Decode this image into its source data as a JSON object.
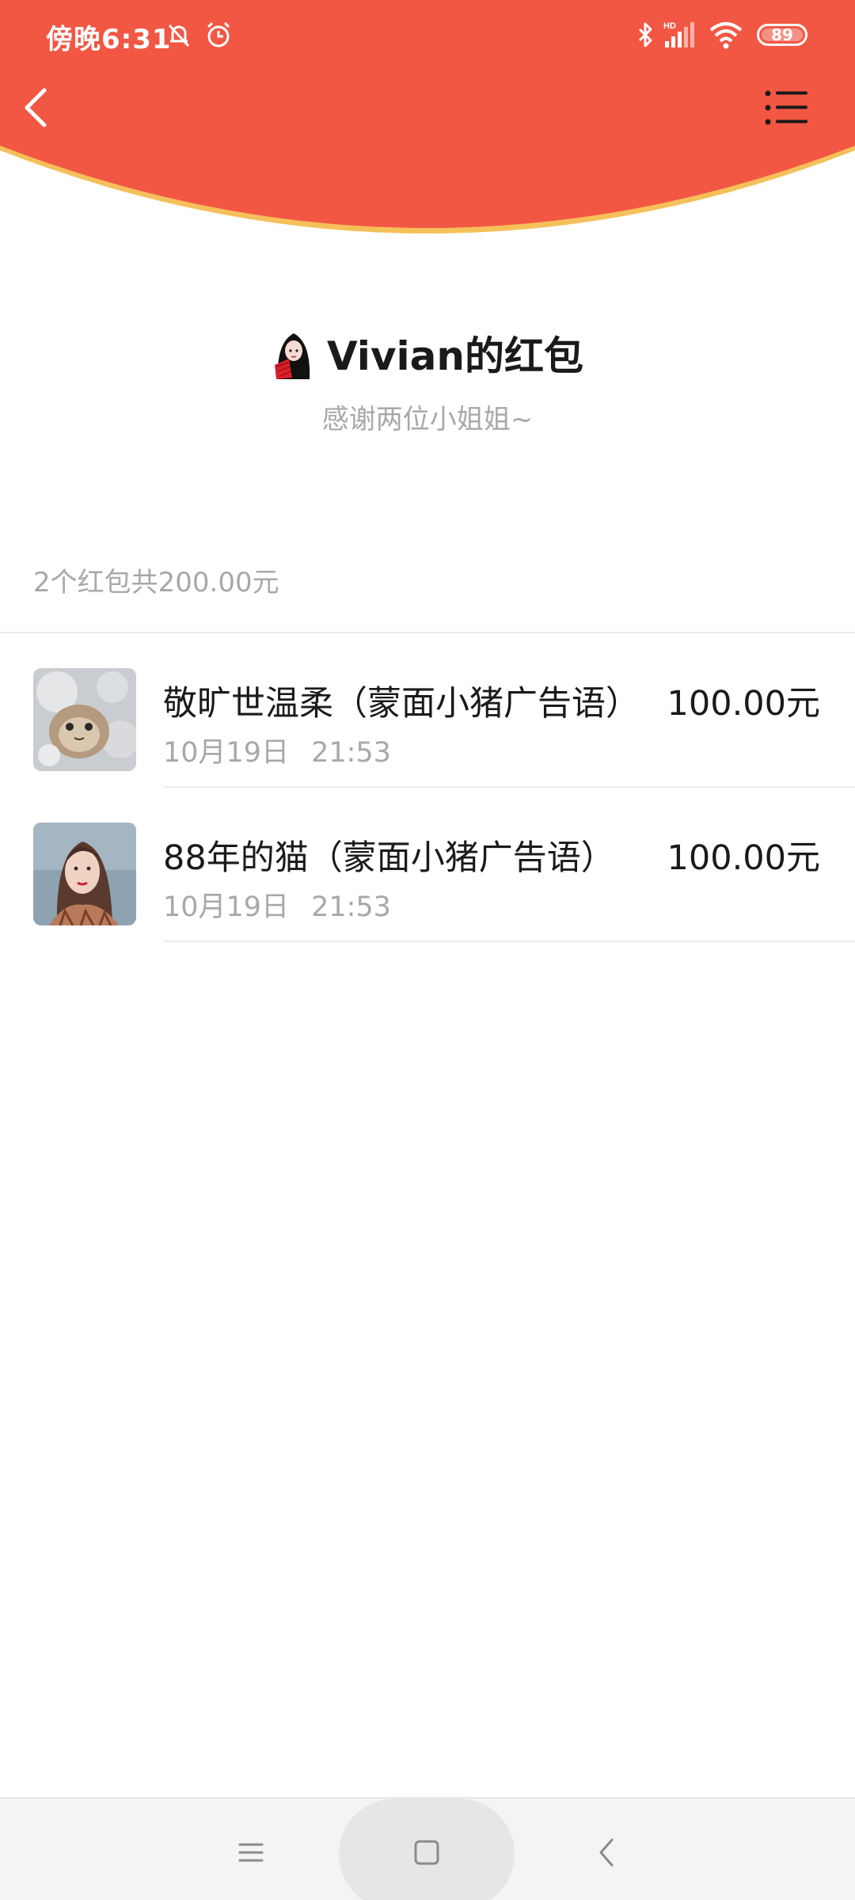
{
  "status_bar": {
    "time": "傍晚6:31",
    "battery": "89",
    "icons": [
      "mute-bell-icon",
      "alarm-icon",
      "bluetooth-icon",
      "hd-signal-icon",
      "wifi-icon",
      "battery-icon"
    ]
  },
  "header": {
    "color": "#f25744",
    "edge_color": "#f5c05a",
    "back_icon": "back-chevron-icon",
    "menu_icon": "list-menu-icon"
  },
  "envelope": {
    "title": "Vivian的红包",
    "message": "感谢两位小姐姐~"
  },
  "summary": {
    "text": "2个红包共200.00元"
  },
  "receivers": [
    {
      "name": "敬旷世温柔（蒙面小猪广告语）",
      "date": "10月19日",
      "time": "21:53",
      "amount": "100.00元"
    },
    {
      "name": "88年的猫（蒙面小猪广告语）",
      "date": "10月19日",
      "time": "21:53",
      "amount": "100.00元"
    }
  ],
  "nav_bar": {
    "icons": [
      "recents-menu-icon",
      "home-square-icon",
      "back-triangle-icon"
    ]
  }
}
